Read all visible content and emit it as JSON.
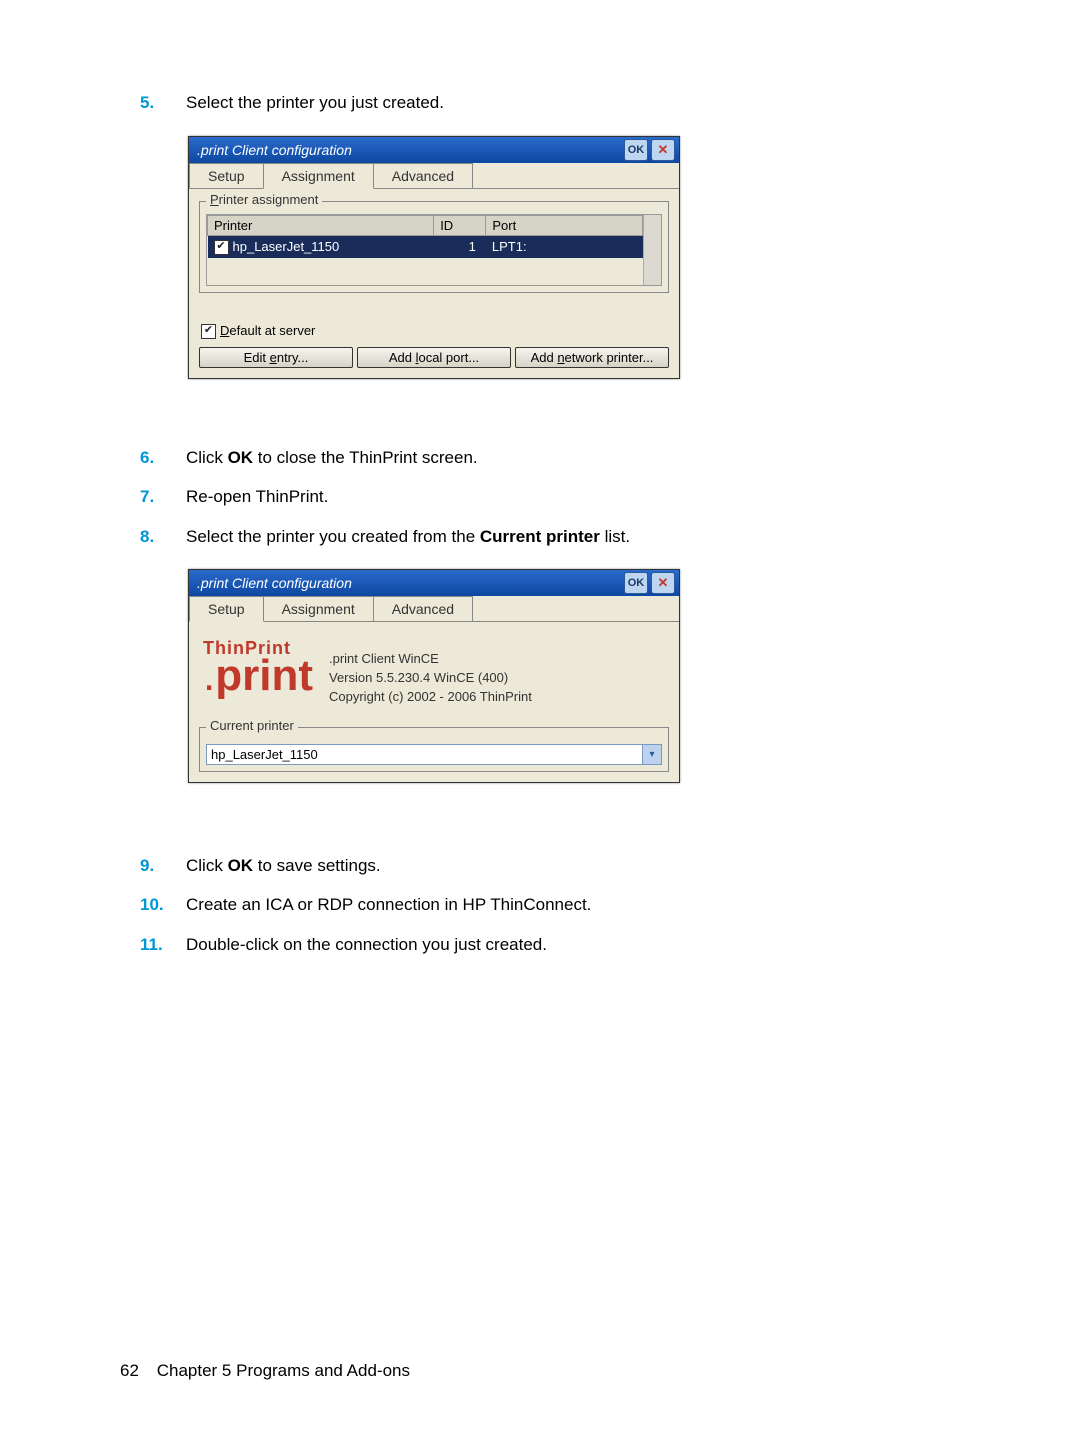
{
  "steps": {
    "s5": {
      "num": "5.",
      "text": "Select the printer you just created."
    },
    "s6": {
      "num": "6.",
      "prefix": "Click ",
      "bold": "OK",
      "suffix": " to close the ThinPrint screen."
    },
    "s7": {
      "num": "7.",
      "text": "Re-open ThinPrint."
    },
    "s8": {
      "num": "8.",
      "prefix": "Select the printer you created from the ",
      "bold": "Current printer",
      "suffix": " list."
    },
    "s9": {
      "num": "9.",
      "prefix": "Click ",
      "bold": "OK",
      "suffix": " to save settings."
    },
    "s10": {
      "num": "10.",
      "text": "Create an ICA or RDP connection in HP ThinConnect."
    },
    "s11": {
      "num": "11.",
      "text": "Double-click on the connection you just created."
    }
  },
  "dialog1": {
    "title": ".print Client configuration",
    "ok": "OK",
    "tabs": {
      "setup": "Setup",
      "assignment": "Assignment",
      "advanced": "Advanced"
    },
    "group_label_pre": "P",
    "group_label_post": "rinter assignment",
    "cols": {
      "printer": "Printer",
      "id": "ID",
      "port": "Port"
    },
    "row": {
      "name": "hp_LaserJet_1150",
      "id": "1",
      "port": "LPT1:"
    },
    "default_pre": "D",
    "default_post": "efault at server",
    "buttons": {
      "edit_pre": "Edit ",
      "edit_u": "e",
      "edit_post": "ntry...",
      "addlocal_pre": "Add ",
      "addlocal_u": "l",
      "addlocal_post": "ocal port...",
      "addnet_pre": "Add ",
      "addnet_u": "n",
      "addnet_post": "etwork printer..."
    }
  },
  "dialog2": {
    "title": ".print Client configuration",
    "ok": "OK",
    "tabs": {
      "setup": "Setup",
      "assignment": "Assignment",
      "advanced": "Advanced"
    },
    "logo_top": "ThinPrint",
    "logo_dot": ".",
    "logo_main": "print",
    "info1": ".print Client WinCE",
    "info2": "Version 5.5.230.4 WinCE (400)",
    "info3": "Copyright (c) 2002 - 2006 ThinPrint",
    "group_label": "Current printer",
    "selected": "hp_LaserJet_1150"
  },
  "footer": {
    "page": "62",
    "chapter": "Chapter 5   Programs and Add-ons"
  }
}
